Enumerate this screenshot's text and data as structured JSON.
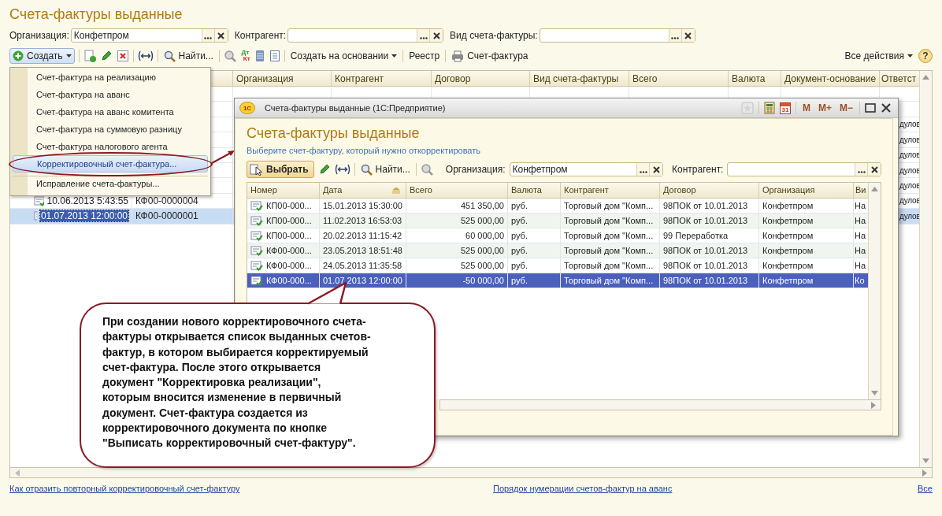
{
  "title": "Счета-фактуры выданные",
  "filters": [
    {
      "label": "Организация:",
      "value": "Конфетпром"
    },
    {
      "label": "Контрагент:"
    },
    {
      "label": "Вид счета-фактуры:"
    }
  ],
  "toolbar": {
    "create": "Создать",
    "find": "Найти...",
    "dt": "Дт",
    "kt": "Кт",
    "create_based": "Создать на основании",
    "registry": "Реестр",
    "print": "Счет-фактура",
    "all_actions": "Все действия",
    "help": "?"
  },
  "table": {
    "columns": [
      "Организация",
      "Контрагент",
      "Договор",
      "Вид счета-фактуры",
      "Всего",
      "Валюта",
      "Документ-основание",
      "Ответст"
    ],
    "rows": [
      {
        "selected": false
      },
      {
        "selected": false
      },
      {
        "responsible": "дулов",
        "selected": false
      },
      {
        "responsible": "дулов",
        "selected": false
      },
      {
        "responsible": "дулов",
        "selected": false
      },
      {
        "responsible": "дулов",
        "selected": false
      },
      {
        "responsible": "дулов",
        "selected": false
      },
      {
        "date": "10.06.2013 5:43:55",
        "number": "КФ00-0000004",
        "responsible": "дулов",
        "selected": false
      },
      {
        "date": "01.07.2013 12:00:00",
        "number": "КФ00-0000001",
        "responsible": "дулов",
        "selected": true
      }
    ]
  },
  "create_menu": [
    {
      "label": "Счет-фактура на реализацию",
      "selected": false,
      "separated": false
    },
    {
      "label": "Счет-фактура на аванс",
      "selected": false,
      "separated": false
    },
    {
      "label": "Счет-фактура на аванс комитента",
      "selected": false,
      "separated": false
    },
    {
      "label": "Счет-фактура на суммовую разницу",
      "selected": false,
      "separated": false
    },
    {
      "label": "Счет-фактура налогового агента",
      "selected": false,
      "separated": false
    },
    {
      "label": "Корректировочный счет-фактура...",
      "selected": true,
      "separated": false
    },
    {
      "label": "Исправление счета-фактуры...",
      "selected": false,
      "separated": true
    }
  ],
  "dialog": {
    "app_icon": "1С",
    "title": "Счета-фактуры выданные  (1С:Предприятие)",
    "calendar_day": "31",
    "memory_buttons": [
      "M",
      "M+",
      "M−"
    ],
    "heading": "Счета-фактуры выданные",
    "hint": "Выберите счет-фактуру, который нужно откорректировать",
    "select_button": "Выбрать",
    "find": "Найти...",
    "filters": [
      {
        "label": "Организация:",
        "value": "Конфетпром"
      },
      {
        "label": "Контрагент:"
      }
    ],
    "columns": [
      {
        "label": "Номер",
        "sorted": false
      },
      {
        "label": "Дата",
        "sorted": true
      },
      {
        "label": "Всего",
        "sorted": false
      },
      {
        "label": "Валюта",
        "sorted": false
      },
      {
        "label": "Контрагент",
        "sorted": false
      },
      {
        "label": "Договор",
        "sorted": false
      },
      {
        "label": "Организация",
        "sorted": false
      },
      {
        "label": "Ви",
        "sorted": false
      }
    ],
    "rows": [
      {
        "cells": [
          "КП00-000...",
          "15.01.2013 15:30:00",
          "451 350,00",
          "руб.",
          "Торговый дом \"Комп...",
          "98ПОК от 10.01.2013",
          "Конфетпром",
          "На"
        ],
        "selected": false
      },
      {
        "cells": [
          "КП00-000...",
          "11.02.2013 16:53:03",
          "525 000,00",
          "руб.",
          "Торговый дом \"Комп...",
          "98ПОК от 10.01.2013",
          "Конфетпром",
          "На"
        ],
        "selected": false
      },
      {
        "cells": [
          "КП00-000...",
          "20.02.2013 11:15:42",
          "60 000,00",
          "руб.",
          "Торговый дом \"Комп...",
          "99 Переработка",
          "Конфетпром",
          "На"
        ],
        "selected": false
      },
      {
        "cells": [
          "КФ00-000...",
          "23.05.2013 18:51:48",
          "525 000,00",
          "руб.",
          "Торговый дом \"Комп...",
          "98ПОК от 10.01.2013",
          "Конфетпром",
          "На"
        ],
        "selected": false
      },
      {
        "cells": [
          "КФ00-000...",
          "24.05.2013 11:35:58",
          "525 000,00",
          "руб.",
          "Торговый дом \"Комп...",
          "98ПОК от 10.01.2013",
          "Конфетпром",
          "На"
        ],
        "selected": false
      },
      {
        "cells": [
          "КФ00-000...",
          "01.07.2013 12:00:00",
          "-50 000,00",
          "руб.",
          "Торговый дом \"Комп...",
          "98ПОК от 10.01.2013",
          "Конфетпром",
          "Ко"
        ],
        "selected": true
      }
    ]
  },
  "callout": "При создании нового корректировочного счета-\nфактуры открывается список выданных счетов-\nфактур, в котором выбирается корректируемый\nсчет-фактура. После этого открывается\nдокумент \"Корректировка реализации\",\nкоторым вносится изменение в первичный\nдокумент. Счет-фактура создается из\nкорректировочного документа по кнопке\n\"Выписать корректировочный счет-фактуру\".",
  "footer_links": [
    "Как отразить повторный корректировочный счет-фактуру",
    "Порядок нумерации счетов-фактур на аванс",
    "Все"
  ]
}
